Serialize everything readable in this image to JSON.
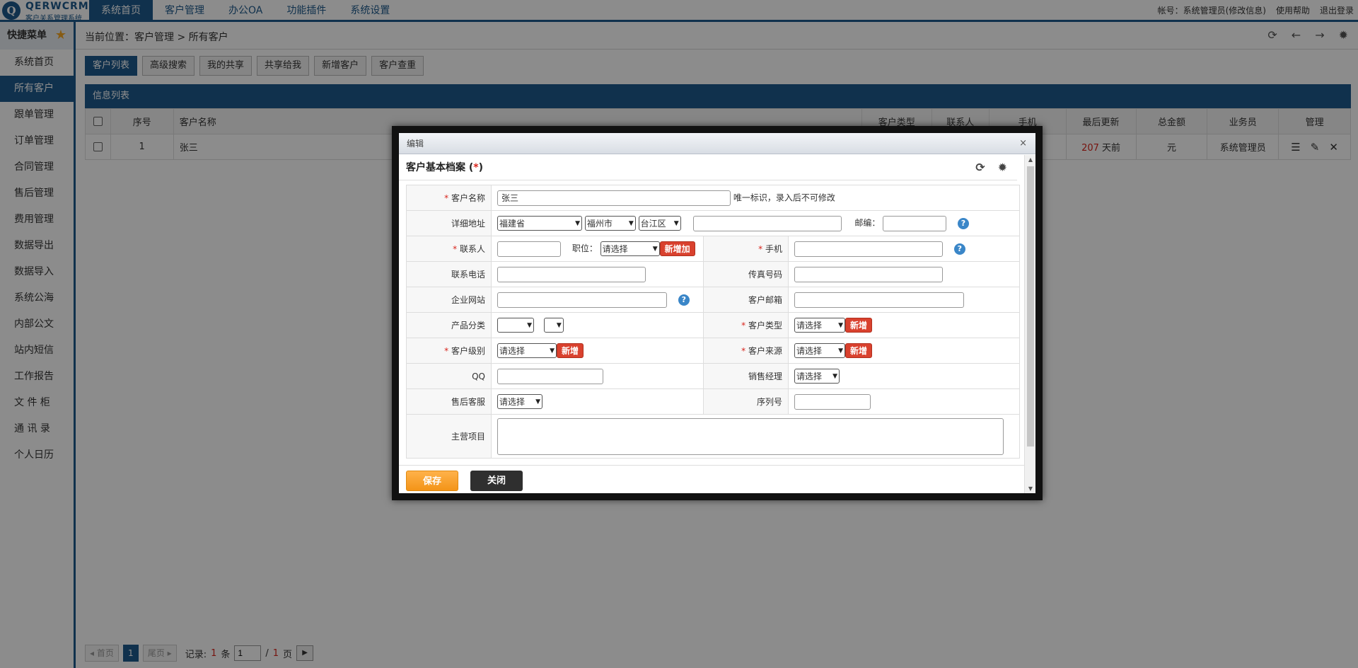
{
  "app": {
    "logo_letter": "Q",
    "title": "QERWCRM",
    "subtitle": "客户关系管理系统"
  },
  "nav": [
    "系统首页",
    "客户管理",
    "办公OA",
    "功能插件",
    "系统设置"
  ],
  "top_right": {
    "account": "帐号：系统管理员(修改信息)",
    "help": "使用帮助",
    "logout": "退出登录"
  },
  "sidebar": {
    "title": "快捷菜单",
    "items": [
      "系统首页",
      "所有客户",
      "跟单管理",
      "订单管理",
      "合同管理",
      "售后管理",
      "费用管理",
      "数据导出",
      "数据导入",
      "系统公海",
      "内部公文",
      "站内短信",
      "工作报告",
      "文 件 柜",
      "通 讯 录",
      "个人日历"
    ]
  },
  "breadcrumb": "当前位置：客户管理 > 所有客户",
  "tabs": [
    "客户列表",
    "高级搜索",
    "我的共享",
    "共享给我",
    "新增客户",
    "客户查重"
  ],
  "list_title": "信息列表",
  "table": {
    "headers": [
      "序号",
      "客户名称",
      "客户类型",
      "联系人",
      "手机",
      "最后更新",
      "总金额",
      "业务员",
      "管理"
    ],
    "row": {
      "no": "1",
      "name": "张三",
      "days": "207",
      "days_suffix": " 天前",
      "amount": "元",
      "owner": "系统管理员"
    }
  },
  "pager": {
    "first": "◂ 首页",
    "page": "1",
    "last": "尾页 ▸",
    "records_label": "记录:",
    "records": "1",
    "records_unit": "条",
    "page_input": "1",
    "slash": "/",
    "total": "1",
    "total_unit": "页"
  },
  "modal": {
    "title": "编辑",
    "close": "×",
    "form_title": "客户基本档案 (",
    "form_title_star": "*",
    "form_title_end": ")",
    "name_label": "客户名称",
    "name_value": "张三",
    "name_hint": "唯一标识，录入后不可修改",
    "address_label": "详细地址",
    "province": "福建省",
    "city": "福州市",
    "district": "台江区",
    "zip_label": "邮编：",
    "contact_label": "联系人",
    "position_label": "职位：",
    "select_placeholder": "请选择",
    "add_new_long": "新增加",
    "mobile_label": "手机",
    "phone_label": "联系电话",
    "fax_label": "传真号码",
    "website_label": "企业网站",
    "email_label": "客户邮箱",
    "product_label": "产品分类",
    "type_label": "客户类型",
    "add_new": "新增",
    "level_label": "客户级别",
    "source_label": "客户来源",
    "qq_label": "QQ",
    "sales_label": "销售经理",
    "service_label": "售后客服",
    "serial_label": "序列号",
    "business_label": "主营项目",
    "save": "保存",
    "close_btn": "关闭"
  },
  "colors": {
    "brand": "#1e5a8c",
    "danger": "#d9412e",
    "save": "#f39418"
  }
}
